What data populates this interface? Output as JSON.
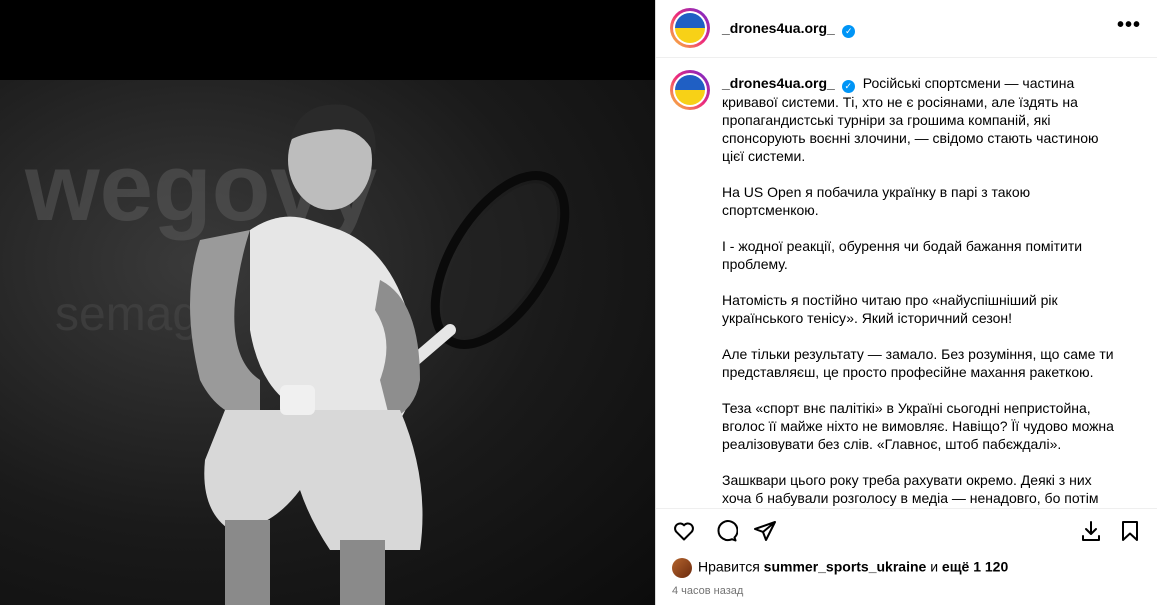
{
  "post": {
    "username": "_drones4ua.org_",
    "more_label": "•••",
    "caption_paragraphs": [
      "На US Open я побачила українку в парі з такою спортсменкою.",
      "І - жодної реакції, обурення чи бодай бажання помітити проблему.",
      "Натомість я постійно читаю про «найуспішніший рік українського тенісу». Який історичний сезон!",
      "Але тільки результату — замало. Без розуміння, що саме ти представляєш, це просто професійне махання ракеткою.",
      "Теза «спорт внє палітікі» в Україні сьогодні непристойна, вголос її майже ніхто не вимовляє. Навіщо? Її чудово можна реалізовувати без слів. «Главноє, штоб пабєждалі».",
      "Зашквари цього року треба рахувати окремо. Деякі з них хоча б набували розголосу в медіа — ненадовго, бо потім усі поверталися до рахунків і жеребкувань. Цього разу навіть"
    ],
    "caption_first": "Російські спортсмени — частина кривавої системи. Ті, хто не є росіянами, але їздять на пропагандистські турніри за грошима компаній, які спонсорують воєнні злочини, — свідомо стають частиною цієї системи.",
    "likes_prefix": "Нравится",
    "likes_user": "summer_sports_ukraine",
    "likes_mid": "и",
    "likes_more": "ещё 1 120",
    "time": "4 часов назад"
  },
  "colors": {
    "verified": "#0095f6",
    "flag_blue": "#1f5fc4",
    "flag_yellow": "#f7d117"
  },
  "icons": [
    "heart-icon",
    "comment-icon",
    "share-icon",
    "save-icon",
    "bookmark-icon",
    "more-icon",
    "verified-icon"
  ]
}
